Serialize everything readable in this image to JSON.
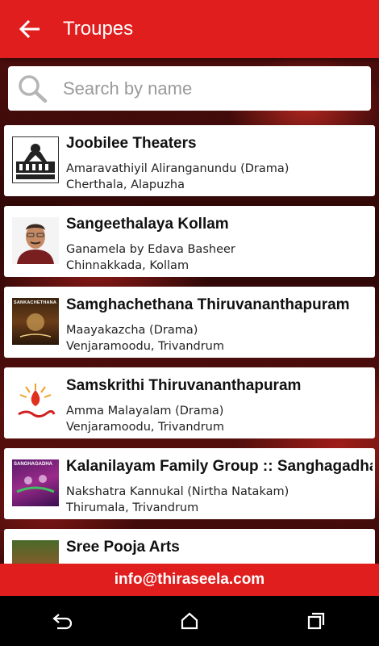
{
  "appbar": {
    "title": "Troupes",
    "back_icon": "arrow-back-icon"
  },
  "search": {
    "placeholder": "Search by name",
    "value": ""
  },
  "troupes": [
    {
      "name": "Joobilee Theaters",
      "description": "Amaravathiyil Aliranganundu (Drama)",
      "location": "Cherthala, Alapuzha",
      "thumb": "theater-logo"
    },
    {
      "name": "Sangeethalaya Kollam",
      "description": "Ganamela by Edava Basheer",
      "location": "Chinnakkada, Kollam",
      "thumb": "person-photo"
    },
    {
      "name": "Samghachethana Thiruvananthapuram",
      "description": "Maayakazcha (Drama)",
      "location": "Venjaramoodu, Trivandrum",
      "thumb": "sankachethana-logo",
      "thumb_label": "SANKACHETHANA"
    },
    {
      "name": "Samskrithi Thiruvananthapuram",
      "description": "Amma Malayalam (Drama)",
      "location": "Venjaramoodu, Trivandrum",
      "thumb": "samskrithi-logo"
    },
    {
      "name": "Kalanilayam Family Group :: Sanghagadha",
      "description": "Nakshatra Kannukal (Nirtha Natakam)",
      "location": "Thirumala, Trivandrum",
      "thumb": "sanghagadha-logo",
      "thumb_label": "SANGHAGADHA"
    },
    {
      "name": "Sree Pooja Arts",
      "description": "",
      "location": "",
      "thumb": "pooja-arts-photo"
    }
  ],
  "footer": {
    "email": "info@thiraseela.com"
  },
  "colors": {
    "primary": "#e01e1e",
    "card": "#ffffff",
    "text": "#111111"
  }
}
